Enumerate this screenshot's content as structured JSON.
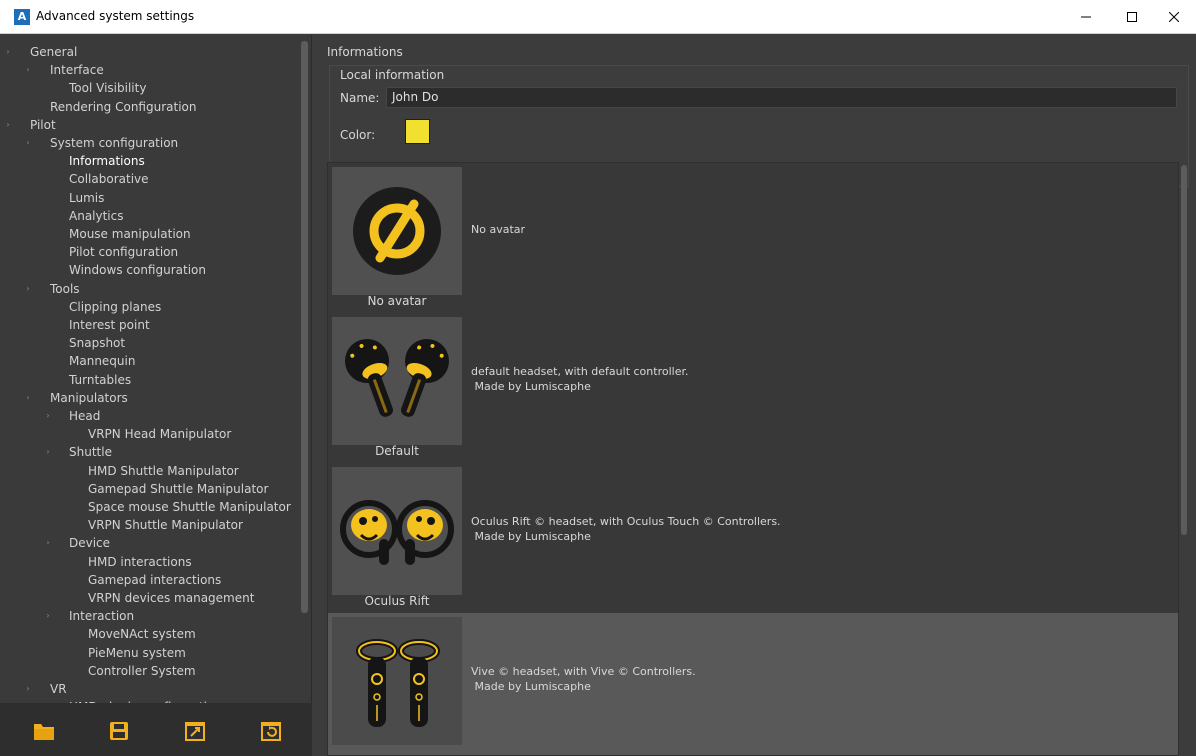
{
  "window": {
    "title": "Advanced system settings",
    "app_icon_letter": "A"
  },
  "tree": [
    {
      "label": "General",
      "level": 0,
      "caret": true
    },
    {
      "label": "Interface",
      "level": 1,
      "caret": true
    },
    {
      "label": "Tool Visibility",
      "level": 2,
      "caret": false
    },
    {
      "label": "Rendering Configuration",
      "level": 1,
      "caret": false
    },
    {
      "label": "Pilot",
      "level": 0,
      "caret": true
    },
    {
      "label": "System configuration",
      "level": 1,
      "caret": true
    },
    {
      "label": "Informations",
      "level": 2,
      "caret": false,
      "selected": true
    },
    {
      "label": "Collaborative",
      "level": 2,
      "caret": false
    },
    {
      "label": "Lumis",
      "level": 2,
      "caret": false
    },
    {
      "label": "Analytics",
      "level": 2,
      "caret": false
    },
    {
      "label": "Mouse manipulation",
      "level": 2,
      "caret": false
    },
    {
      "label": "Pilot configuration",
      "level": 2,
      "caret": false
    },
    {
      "label": "Windows configuration",
      "level": 2,
      "caret": false
    },
    {
      "label": "Tools",
      "level": 1,
      "caret": true
    },
    {
      "label": "Clipping planes",
      "level": 2,
      "caret": false
    },
    {
      "label": "Interest point",
      "level": 2,
      "caret": false
    },
    {
      "label": "Snapshot",
      "level": 2,
      "caret": false
    },
    {
      "label": "Mannequin",
      "level": 2,
      "caret": false
    },
    {
      "label": "Turntables",
      "level": 2,
      "caret": false
    },
    {
      "label": "Manipulators",
      "level": 1,
      "caret": true
    },
    {
      "label": "Head",
      "level": 2,
      "caret": true
    },
    {
      "label": "VRPN Head Manipulator",
      "level": 3,
      "caret": false
    },
    {
      "label": "Shuttle",
      "level": 2,
      "caret": true
    },
    {
      "label": "HMD Shuttle Manipulator",
      "level": 3,
      "caret": false
    },
    {
      "label": "Gamepad Shuttle Manipulator",
      "level": 3,
      "caret": false
    },
    {
      "label": "Space mouse Shuttle Manipulator",
      "level": 3,
      "caret": false
    },
    {
      "label": "VRPN Shuttle Manipulator",
      "level": 3,
      "caret": false
    },
    {
      "label": "Device",
      "level": 2,
      "caret": true
    },
    {
      "label": "HMD interactions",
      "level": 3,
      "caret": false
    },
    {
      "label": "Gamepad interactions",
      "level": 3,
      "caret": false
    },
    {
      "label": "VRPN devices management",
      "level": 3,
      "caret": false
    },
    {
      "label": "Interaction",
      "level": 2,
      "caret": true
    },
    {
      "label": "MoveNAct system",
      "level": 3,
      "caret": false
    },
    {
      "label": "PieMenu system",
      "level": 3,
      "caret": false
    },
    {
      "label": "Controller System",
      "level": 3,
      "caret": false
    },
    {
      "label": "VR",
      "level": 1,
      "caret": true
    },
    {
      "label": "HMD plugin configuration",
      "level": 2,
      "caret": false
    }
  ],
  "bottom_toolbar": {
    "icons": [
      "folder-icon",
      "save-icon",
      "export-icon",
      "reset-icon"
    ],
    "accent": "#f2b01e"
  },
  "content": {
    "section_title": "Informations",
    "local_info": {
      "group_title": "Local information",
      "name_label": "Name:",
      "name_value": "John Do",
      "color_label": "Color:",
      "color_value": "#f1e030"
    },
    "avatars": [
      {
        "caption": "No avatar",
        "desc_line1": "No avatar",
        "desc_line2": "",
        "icon": "no-avatar-icon",
        "selected": false
      },
      {
        "caption": "Default",
        "desc_line1": "default headset, with default controller.",
        "desc_line2": " Made by Lumiscaphe",
        "icon": "default-controllers-icon",
        "selected": false
      },
      {
        "caption": "Oculus Rift",
        "desc_line1": "Oculus Rift © headset, with Oculus Touch © Controllers.",
        "desc_line2": " Made by Lumiscaphe",
        "icon": "oculus-touch-icon",
        "selected": false
      },
      {
        "caption": "",
        "desc_line1": "Vive © headset, with Vive © Controllers.",
        "desc_line2": " Made by Lumiscaphe",
        "icon": "vive-controllers-icon",
        "selected": true
      }
    ]
  }
}
